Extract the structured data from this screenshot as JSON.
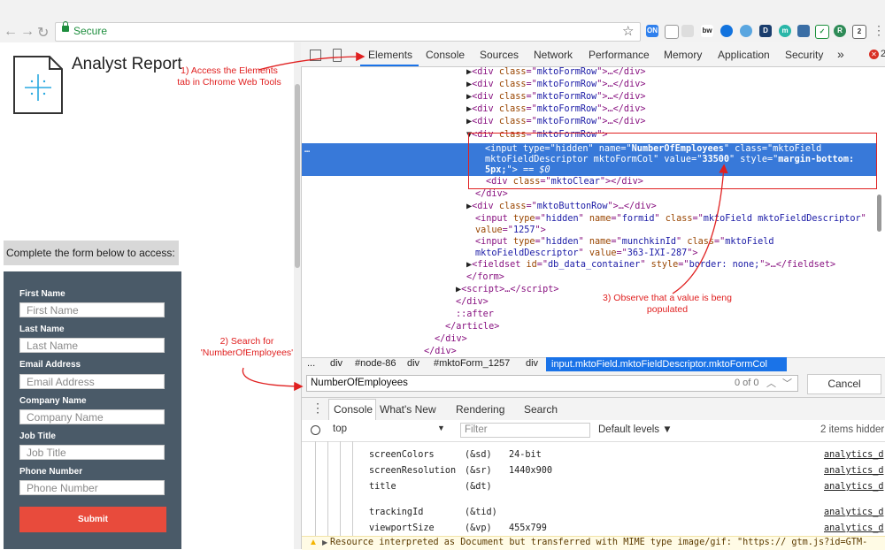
{
  "browser": {
    "secure_label": "Secure",
    "extensions": [
      "ON",
      "bw",
      "m",
      "R",
      "2"
    ]
  },
  "page": {
    "title": "Analyst Report",
    "form_heading": "Complete the form below to access:",
    "fields": [
      {
        "label": "First Name",
        "placeholder": "First Name"
      },
      {
        "label": "Last Name",
        "placeholder": "Last Name"
      },
      {
        "label": "Email Address",
        "placeholder": "Email Address"
      },
      {
        "label": "Company Name",
        "placeholder": "Company Name"
      },
      {
        "label": "Job Title",
        "placeholder": "Job Title"
      },
      {
        "label": "Phone Number",
        "placeholder": "Phone Number"
      }
    ],
    "submit_label": "Submit"
  },
  "annotations": {
    "step1": "1) Access the Elements tab in Chrome Web Tools",
    "step2": "2) Search for 'NumberOfEmployees'",
    "step3": "3) Observe that a value is beng populated"
  },
  "devtools": {
    "tabs": [
      "Elements",
      "Console",
      "Sources",
      "Network",
      "Performance",
      "Memory",
      "Application",
      "Security"
    ],
    "more": "»",
    "error_count": "2",
    "dom": {
      "row_tag": "div",
      "row_class": "mktoFormRow",
      "ellipsis_close": ">…</div>",
      "selected_dots": "…",
      "input_name": "NumberOfEmployees",
      "input_class": "mktoField mktoFieldDescriptor mktoFormCol",
      "input_value": "33500",
      "input_style_1": "margin-bottom:",
      "input_style_2": "5px;",
      "dollar": "== $0",
      "clear_class": "mktoClear",
      "button_row_class": "mktoButtonRow",
      "formid_value": "1257",
      "munchkin_value": "363-IXI-287",
      "fieldset_id": "db_data_container",
      "fieldset_style": "border: none;",
      "after": "::after"
    },
    "breadcrumbs": [
      "...",
      "div",
      "#node-86",
      "div",
      "#mktoForm_1257",
      "div"
    ],
    "breadcrumb_active": "input.mktoField.mktoFieldDescriptor.mktoFormCol",
    "search": {
      "value": "NumberOfEmployees",
      "count": "0 of 0",
      "cancel": "Cancel"
    },
    "drawer_tabs": [
      "Console",
      "What's New",
      "Rendering",
      "Search"
    ],
    "console": {
      "context": "top",
      "filter_placeholder": "Filter",
      "levels": "Default levels ▼",
      "hidden": "2 items hidder",
      "rows": [
        {
          "key": "screenColors",
          "code": "(&sd)",
          "val": "24-bit",
          "src": "analytics_d"
        },
        {
          "key": "screenResolution",
          "code": "(&sr)",
          "val": "1440x900",
          "src": "analytics_d"
        },
        {
          "key": "title",
          "code": "(&dt)",
          "val": "",
          "src": "analytics_d"
        },
        {
          "key": "trackingId",
          "code": "(&tid)",
          "val": "",
          "src": "analytics_d"
        },
        {
          "key": "viewportSize",
          "code": "(&vp)",
          "val": "455x799",
          "src": "analytics_d"
        }
      ],
      "warning": "Resource interpreted as Document but transferred with MIME type image/gif: \"https:// gtm.js?id=GTM-"
    }
  }
}
